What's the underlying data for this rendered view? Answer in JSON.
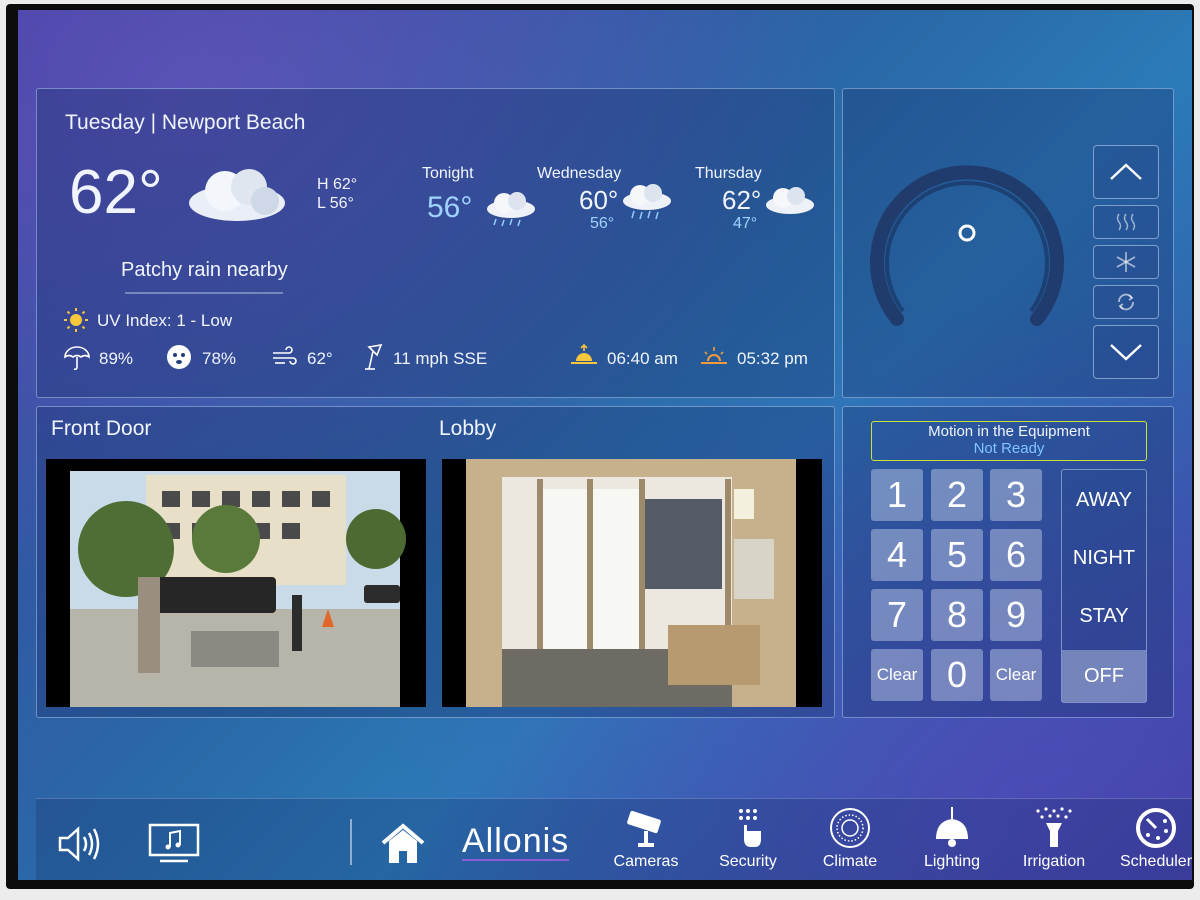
{
  "weather": {
    "location_line": "Tuesday | Newport Beach",
    "current_temp": "62°",
    "high": "H 62°",
    "low": "L 56°",
    "condition": "Patchy rain nearby",
    "uv_index": "UV Index: 1 - Low",
    "stats": {
      "precip": "89%",
      "humidity": "78%",
      "feels_like": "62°",
      "wind": "11 mph SSE",
      "sunrise": "06:40 am",
      "sunset": "05:32 pm"
    },
    "forecast": [
      {
        "label": "Tonight",
        "temp": "56°",
        "low": ""
      },
      {
        "label": "Wednesday",
        "temp": "60°",
        "low": "56°"
      },
      {
        "label": "Thursday",
        "temp": "62°",
        "low": "47°"
      }
    ]
  },
  "cameras": [
    {
      "name": "Front Door"
    },
    {
      "name": "Lobby"
    }
  ],
  "security": {
    "status_line1": "Motion in the Equipment",
    "status_line2": "Not Ready",
    "keys": [
      "1",
      "2",
      "3",
      "4",
      "5",
      "6",
      "7",
      "8",
      "9",
      "Clear",
      "0",
      "Clear"
    ],
    "modes": [
      "AWAY",
      "NIGHT",
      "STAY",
      "OFF"
    ],
    "active_mode": "OFF"
  },
  "nav": {
    "brand": "Allonis",
    "items": [
      {
        "label": "Cameras",
        "icon": "camera-icon"
      },
      {
        "label": "Security",
        "icon": "security-keypad-icon"
      },
      {
        "label": "Climate",
        "icon": "climate-dial-icon"
      },
      {
        "label": "Lighting",
        "icon": "pendant-lamp-icon"
      },
      {
        "label": "Irrigation",
        "icon": "irrigation-icon"
      },
      {
        "label": "Scheduler",
        "icon": "scheduler-clock-icon"
      }
    ]
  },
  "colors": {
    "accent_blue": "#9fd2ff",
    "status_border": "#c8e03a",
    "status_text": "#7fc4ff",
    "sun_yellow": "#f6c63b",
    "sunset_orange": "#f29a3a"
  }
}
